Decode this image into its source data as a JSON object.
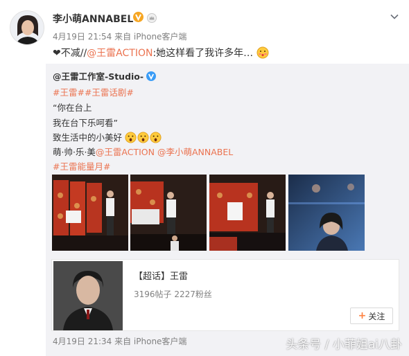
{
  "post": {
    "username": "李小萌ANNABEL",
    "meta": "4月19日 21:54 来自 iPhone客户端",
    "text_prefix": "❤不减//",
    "mention": "@王雷ACTION",
    "text_suffix": ":她这样看了我许多年…"
  },
  "repost": {
    "author": "@王雷工作室-Studio-",
    "tags": "#王雷##王雷话剧#",
    "line1": "“你在台上",
    "line2": "我在台下乐呵看”",
    "line3": "致生活中的小美好",
    "line4_prefix": "萌·帅·乐·美",
    "mention1": "@王雷ACTION",
    "mention2": "@李小萌ANNABEL",
    "tag2": "#王雷能量月#",
    "meta": "4月19日 21:34 来自 iPhone客户端"
  },
  "topic_card": {
    "title": "【超话】王雷",
    "stats": "3196帖子 2227粉丝",
    "follow_label": "关注"
  },
  "watermark": "头条号 / 小菲姐ai八卦",
  "colors": {
    "accent": "#eb7350",
    "verified": "#f6a623",
    "repost_bg": "#f2f2f5"
  }
}
